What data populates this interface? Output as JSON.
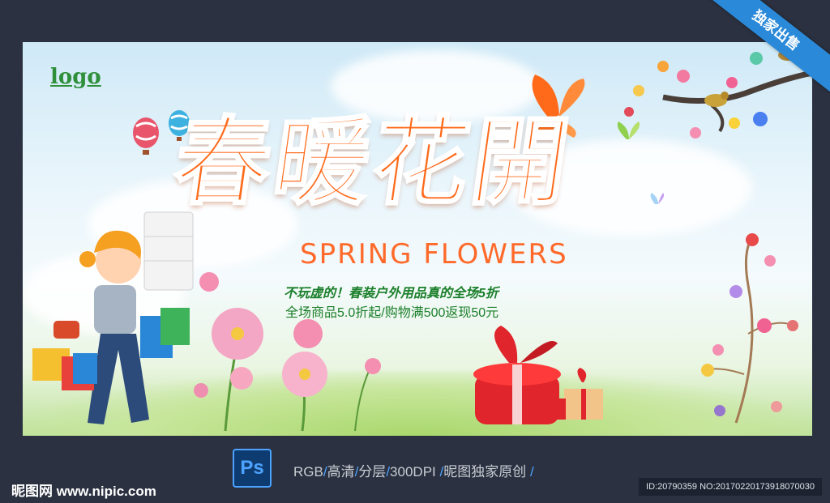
{
  "poster": {
    "logo": "logo",
    "title": "春暖花開",
    "subtitle": "SPRING FLOWERS",
    "slogan": "不玩虚的！春装户外用品真的全场5折",
    "offer": "全场商品5.0折起/购物满500返现50元",
    "ribbon": "独家出售",
    "colors": {
      "title": "#ff6a1a",
      "slogan": "#1a7f2a",
      "ribbon": "#2a8ad9",
      "frame_bg": "#2b3140"
    }
  },
  "footer": {
    "ps_label": "Ps",
    "specs": [
      "RGB",
      "高清",
      "分层",
      "300DPI",
      "昵图独家原创"
    ],
    "brand": "昵图网 www.nipic.com",
    "id_text": "ID:20790359 NO:20170220173918070030"
  },
  "icons": [
    "hot-air-balloon-icon",
    "butterfly-icon",
    "bird-icon",
    "gift-box-icon",
    "shopping-bag-icon",
    "photoshop-icon"
  ]
}
